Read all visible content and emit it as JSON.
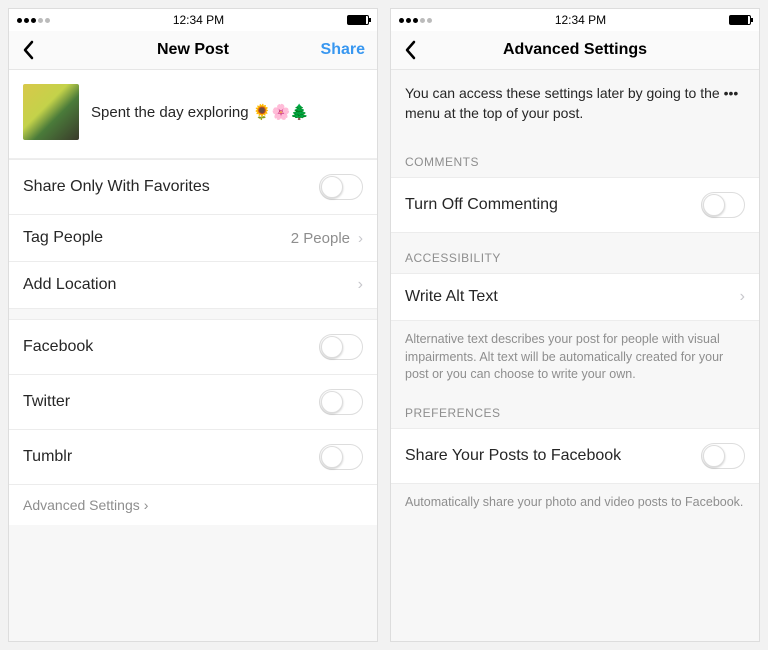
{
  "status": {
    "time": "12:34 PM"
  },
  "left": {
    "title": "New Post",
    "share": "Share",
    "caption": "Spent the day exploring 🌻🌸🌲",
    "favorites_label": "Share Only With Favorites",
    "tag_label": "Tag People",
    "tag_value": "2 People",
    "location_label": "Add Location",
    "social": {
      "fb": "Facebook",
      "tw": "Twitter",
      "tm": "Tumblr"
    },
    "advanced": "Advanced Settings"
  },
  "right": {
    "title": "Advanced Settings",
    "intro": "You can access these settings later by going to the ••• menu at the top of your post.",
    "sections": {
      "comments": {
        "header": "COMMENTS",
        "row": "Turn Off Commenting"
      },
      "accessibility": {
        "header": "ACCESSIBILITY",
        "row": "Write Alt Text",
        "note": "Alternative text describes your post for people with visual impairments. Alt text will be automatically created for your post or you can choose to write your own."
      },
      "preferences": {
        "header": "PREFERENCES",
        "row": "Share Your Posts to Facebook",
        "note": "Automatically share your photo and video posts to Facebook."
      }
    }
  }
}
